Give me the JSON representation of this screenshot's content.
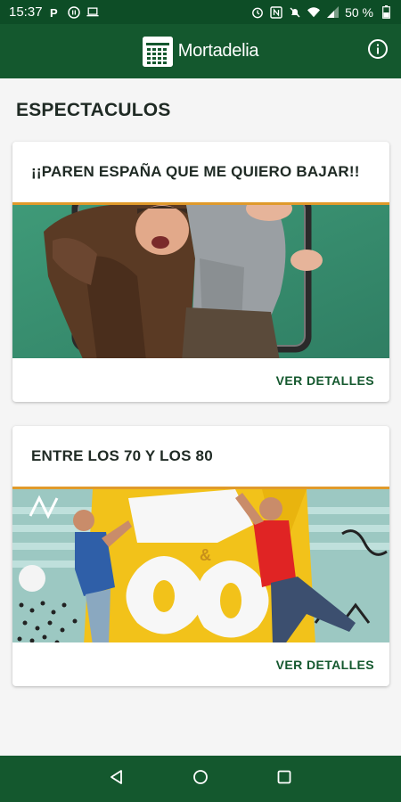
{
  "status_bar": {
    "time": "15:37",
    "battery": "50 %",
    "left_icons": [
      "parking-icon",
      "media-icon",
      "laptop-icon"
    ],
    "right_icons": [
      "alarm-icon",
      "nfc-icon",
      "mute-icon",
      "wifi-icon",
      "signal-icon",
      "battery-icon"
    ]
  },
  "app_bar": {
    "brand": "Mortadelia",
    "info_icon": "info-icon"
  },
  "page": {
    "title": "ESPECTACULOS"
  },
  "shows": [
    {
      "title": "¡¡PAREN ESPAÑA QUE ME QUIERO BAJAR!!",
      "action": "VER DETALLES"
    },
    {
      "title": "ENTRE LOS 70 Y LOS 80",
      "action": "VER DETALLES"
    }
  ],
  "nav": {
    "buttons": [
      "back-icon",
      "home-icon",
      "recents-icon"
    ]
  },
  "colors": {
    "status_bar": "#0d4d26",
    "primary": "#14582e",
    "accent_line": "#e09a2b",
    "text": "#1f2a24",
    "background": "#f5f5f5"
  }
}
